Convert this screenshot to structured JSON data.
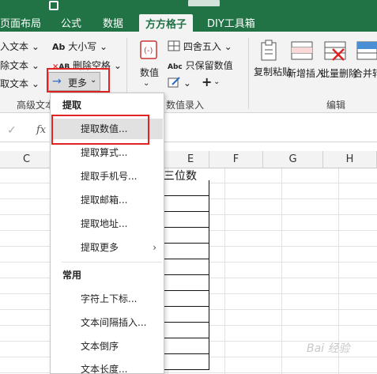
{
  "colors": {
    "excel_green": "#217346",
    "ribbon_bg": "#f3f3f3",
    "highlight_red": "#e02424"
  },
  "tabs": [
    "页面布局",
    "公式",
    "数据",
    "方方格子",
    "DIY工具箱"
  ],
  "active_tab": "方方格子",
  "ribbon": {
    "advanced_text": {
      "items": [
        "入文本",
        "除文本",
        "取文本"
      ],
      "case_label": "大小写",
      "remove_space_label": "删除空格",
      "more_label": "更多",
      "group_label": "高级文本"
    },
    "numeric": {
      "value_label": "数值",
      "round_label": "四舍五入",
      "keep_value_label": "只保留数值",
      "group_label": "数值录入"
    },
    "edit": {
      "copy_paste_label": "复制粘贴",
      "insert_label": "新增插入",
      "batch_delete_label": "批量删除",
      "merge_label": "合并转换",
      "group_label": "编辑"
    }
  },
  "formula_bar": {
    "fx_label": "fx",
    "check_icon": "check-icon"
  },
  "columns": [
    "C",
    "E",
    "F",
    "G",
    "H"
  ],
  "cell_e_header": "三位数",
  "menu": {
    "section_extract": "提取",
    "extract_items": [
      "提取数值...",
      "提取算式...",
      "提取手机号...",
      "提取邮箱...",
      "提取地址...",
      "提取更多"
    ],
    "section_common": "常用",
    "common_items": [
      "字符上下标...",
      "文本间隔插入...",
      "文本倒序",
      "文本长度..."
    ]
  },
  "watermark": "Bai 经验"
}
